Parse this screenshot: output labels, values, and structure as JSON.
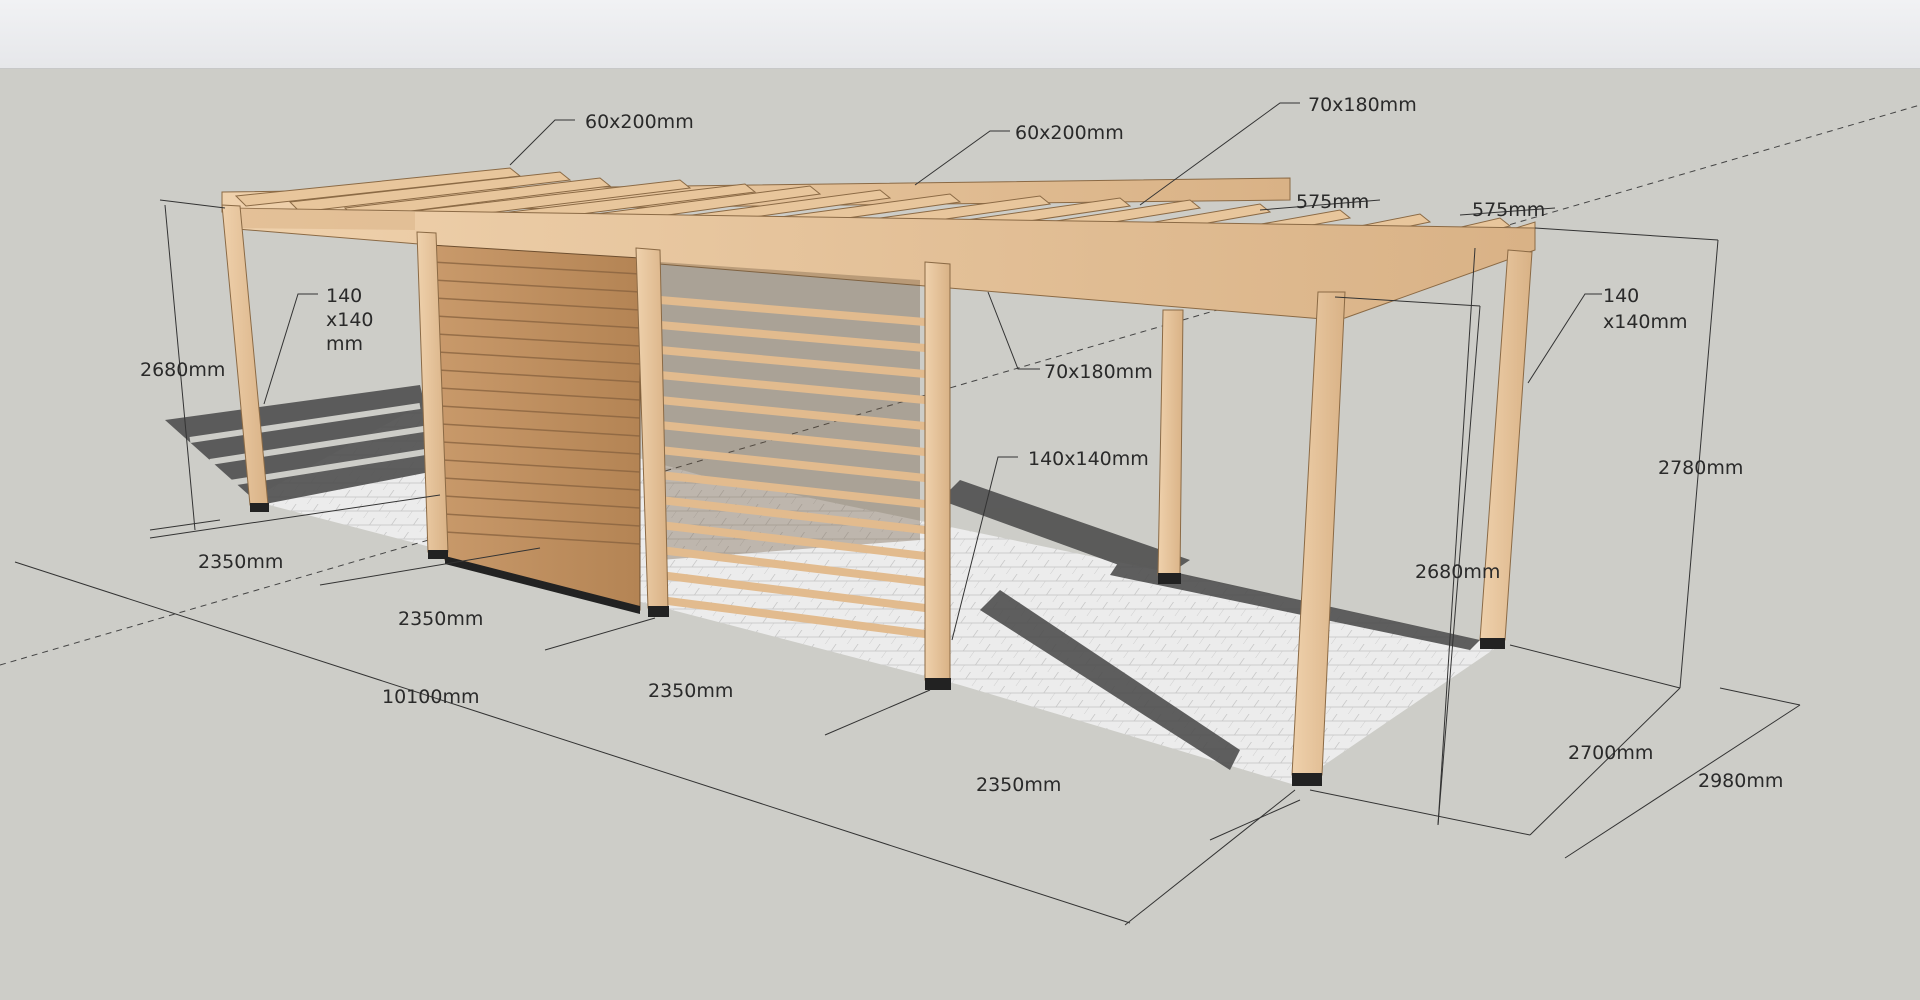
{
  "colors": {
    "background": "#cdcdc8",
    "wood": "#e7c7a0",
    "wood_dark": "#b98e63",
    "paving": "#e9e9e9",
    "shadow": "#4a4a4a",
    "dimension_line": "#333333"
  },
  "labels": {
    "beam_left": "60x200mm",
    "beam_mid": "60x200mm",
    "rafter_top": "70x180mm",
    "spacing_a": "575mm",
    "spacing_b": "575mm",
    "post_left_l1": "140",
    "post_left_l2": "x140",
    "post_left_l3": "mm",
    "post_right_l1": "140",
    "post_right_l2": "x140mm",
    "rafter_mid": "70x180mm",
    "post_mid": "140x140mm",
    "height_left": "2680mm",
    "height_right_inner": "2680mm",
    "height_right_outer": "2780mm",
    "bay_1": "2350mm",
    "bay_2": "2350mm",
    "bay_3": "2350mm",
    "bay_4": "2350mm",
    "total_length": "10100mm",
    "depth_inner": "2700mm",
    "depth_outer": "2980mm"
  }
}
